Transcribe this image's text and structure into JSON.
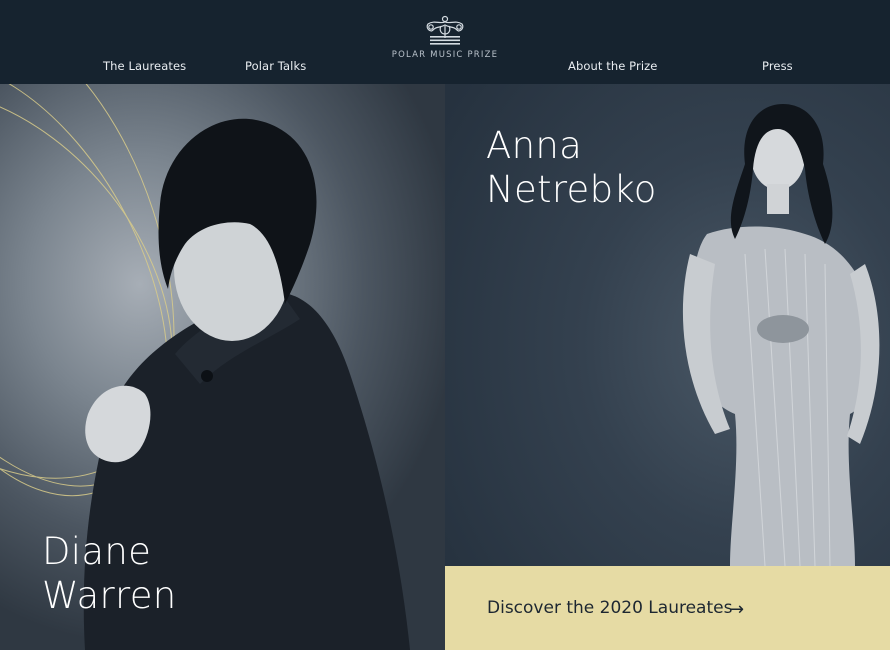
{
  "nav": {
    "laureates": "The Laureates",
    "polar_talks": "Polar Talks",
    "logo_text": "POLAR MUSIC PRIZE",
    "about": "About the Prize",
    "press": "Press"
  },
  "laureates": {
    "left": {
      "first": "Diane",
      "last": "Warren"
    },
    "right": {
      "first": "Anna",
      "last": "Netrebko"
    }
  },
  "cta": {
    "label": "Discover the 2020 Laureates",
    "arrow": "→"
  },
  "colors": {
    "header_bg": "#16232f",
    "cta_bg": "#e6dba4",
    "accent_lines": "#d9cc8a"
  },
  "icons": [
    "polar-crown-logo-icon",
    "arrow-right-icon"
  ]
}
